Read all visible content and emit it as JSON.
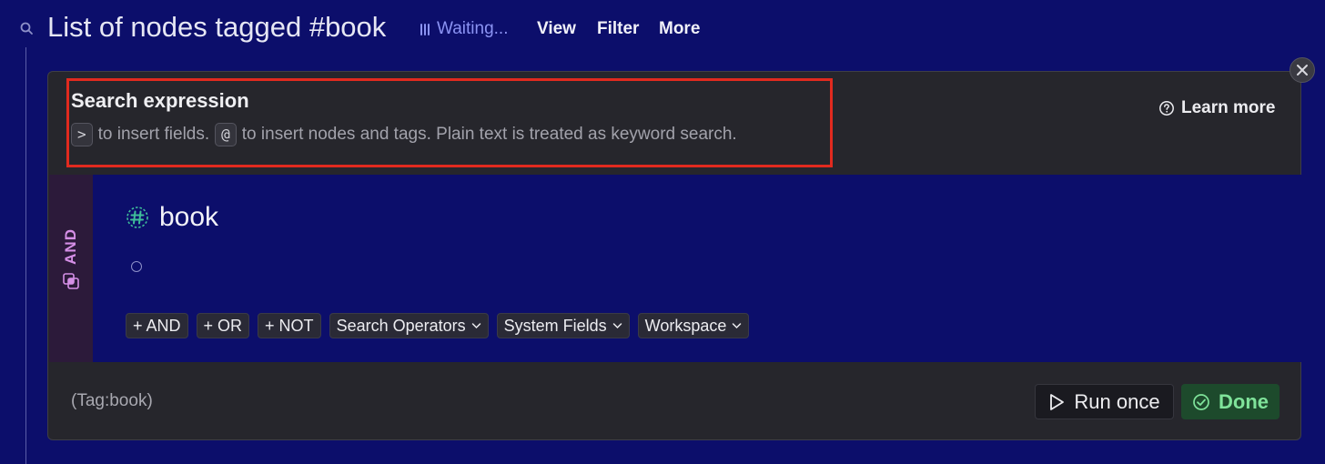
{
  "header": {
    "title": "List of nodes tagged #book",
    "status": "Waiting...",
    "links": [
      "View",
      "Filter",
      "More"
    ]
  },
  "panel": {
    "title": "Search expression",
    "hint": {
      "key1": ">",
      "text1": "to insert fields.",
      "key2": "@",
      "text2": "to insert nodes and tags. Plain text is treated as keyword search."
    },
    "learn_more": "Learn more"
  },
  "query": {
    "operator": "AND",
    "tag": "book",
    "chips": [
      {
        "label": "+ AND"
      },
      {
        "label": "+ OR"
      },
      {
        "label": "+ NOT"
      },
      {
        "label": "Search Operators"
      },
      {
        "label": "System Fields"
      },
      {
        "label": "Workspace"
      }
    ]
  },
  "footer": {
    "preview": "(Tag:book)",
    "run_once": "Run once",
    "done": "Done"
  },
  "colors": {
    "background": "#0c0e6b",
    "panel": "#26262c",
    "accent_and": "#d58fe6",
    "done_green": "#7fe39a",
    "highlight": "#e12a1f"
  }
}
